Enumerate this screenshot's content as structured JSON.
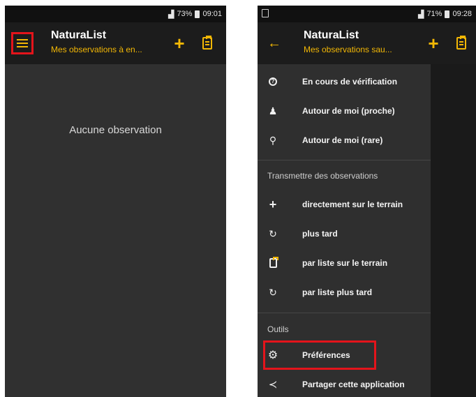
{
  "colors": {
    "accent": "#f2b705",
    "highlight_red": "#e4141b",
    "appbar": "#1c1c1c",
    "content": "#303030"
  },
  "left_screen": {
    "status": {
      "battery": "73%",
      "time": "09:01"
    },
    "appbar": {
      "title": "NaturaList",
      "subtitle": "Mes observations à en...",
      "icons": [
        "menu-icon",
        "plus-icon",
        "clipboard-icon"
      ]
    },
    "empty_message": "Aucune observation"
  },
  "right_screen": {
    "status": {
      "battery": "71%",
      "time": "09:28"
    },
    "appbar": {
      "title": "NaturaList",
      "subtitle": "Mes observations sau...",
      "icons": [
        "back-arrow-icon",
        "plus-icon",
        "clipboard-icon"
      ]
    },
    "drawer": {
      "items_top": [
        {
          "icon": "help-circle-icon",
          "label": "En cours de vérification"
        },
        {
          "icon": "person-location-icon",
          "label": "Autour de moi (proche)"
        },
        {
          "icon": "map-pin-icon",
          "label": "Autour de moi (rare)"
        }
      ],
      "section_transmit": "Transmettre des observations",
      "items_transmit": [
        {
          "icon": "plus-icon",
          "label": "directement sur le terrain"
        },
        {
          "icon": "refresh-icon",
          "label": "plus tard"
        },
        {
          "icon": "clipboard-icon",
          "label": "par liste sur le terrain"
        },
        {
          "icon": "refresh-list-icon",
          "label": "par liste plus tard"
        }
      ],
      "section_tools": "Outils",
      "items_tools": [
        {
          "icon": "gear-icon",
          "label": "Préférences"
        },
        {
          "icon": "share-icon",
          "label": "Partager cette application"
        }
      ]
    }
  }
}
